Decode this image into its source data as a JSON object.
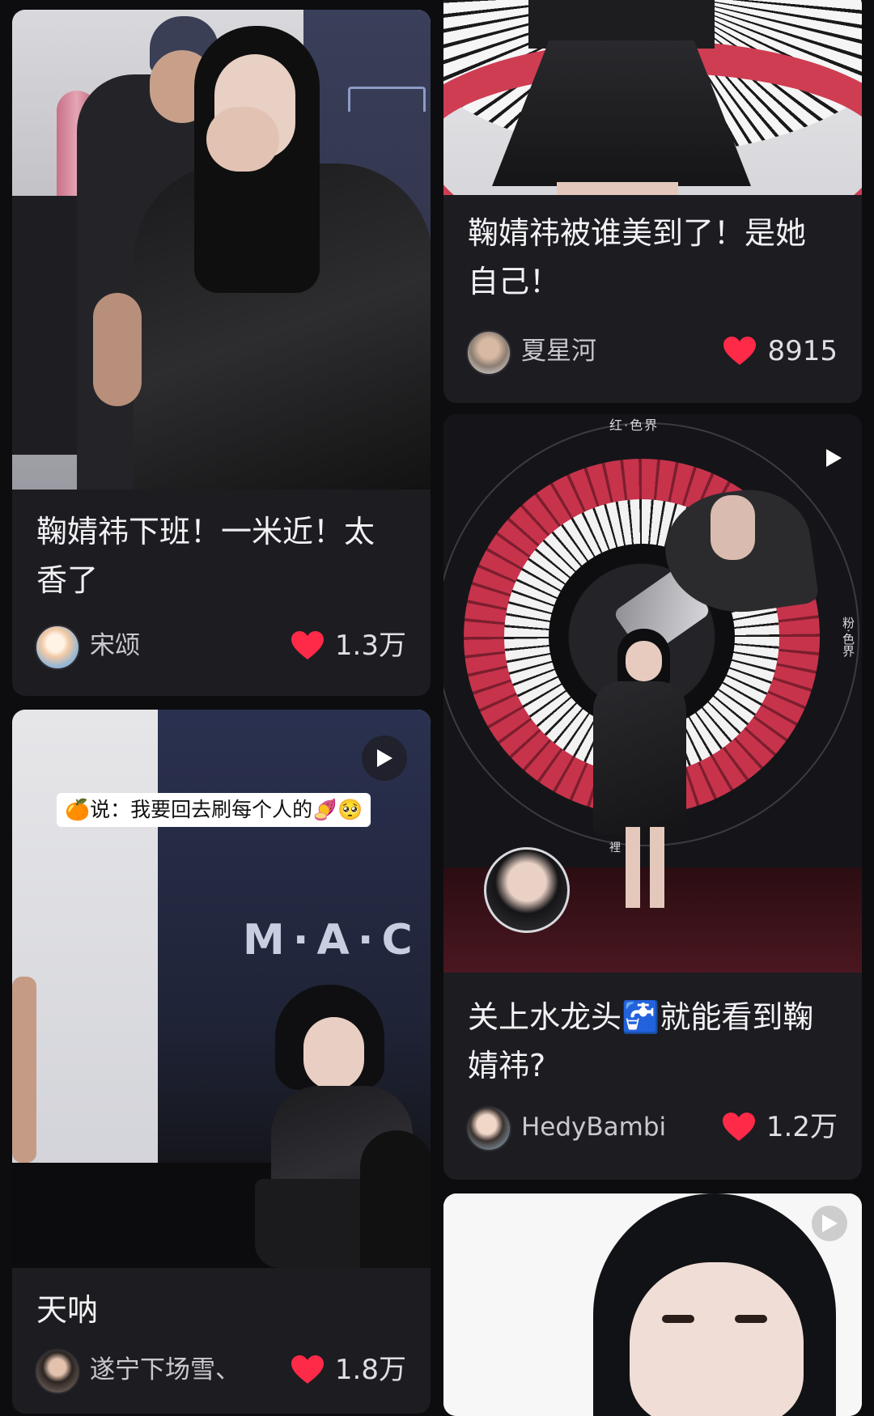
{
  "feed": {
    "cards": [
      {
        "title": "鞠婧祎下班！一米近！太香了",
        "author": "宋颂",
        "likes": "1.3万",
        "has_video": false
      },
      {
        "title": "天呐",
        "author": "遂宁下场雪、",
        "likes": "1.8万",
        "has_video": true,
        "caption": "🍊说：我要回去刷每个人的🍠🥺",
        "watermark": "M·A·C"
      },
      {
        "title": "鞠婧祎被谁美到了！是她自己！",
        "author": "夏星河",
        "likes": "8915",
        "has_video": false
      },
      {
        "title": "关上水龙头🚰就能看到鞠婧祎?",
        "author": "HedyBambi",
        "likes": "1.2万",
        "has_video": true,
        "image_text_top": "红·色界",
        "image_text_side": "粉·色界",
        "image_text_small": "裡"
      },
      {
        "title": "",
        "author": "",
        "likes": "",
        "has_video": true
      }
    ]
  },
  "colors": {
    "background": "#0d0d10",
    "card": "#1c1c21",
    "heart": "#ff2a48",
    "text": "#f2f2f5"
  },
  "icons": [
    "heart-icon",
    "play-icon",
    "avatar"
  ]
}
